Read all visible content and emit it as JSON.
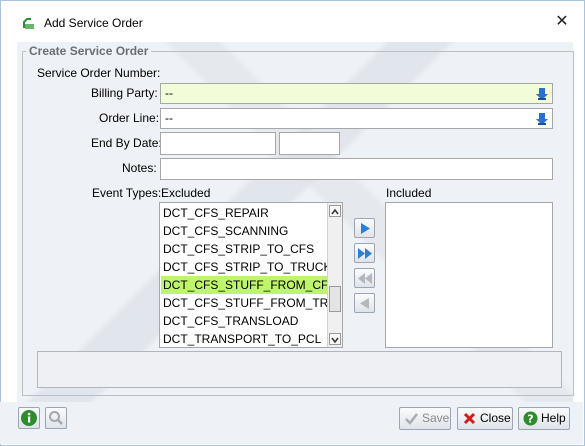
{
  "window": {
    "title": "Add Service Order"
  },
  "group": {
    "legend": "Create Service Order"
  },
  "form": {
    "service_order_number_label": "Service Order Number:",
    "billing_party_label": "Billing Party:",
    "billing_party_value": "--",
    "order_line_label": "Order Line:",
    "order_line_value": "--",
    "end_by_date_label": "End By Date:",
    "end_by_date_value": "",
    "end_by_time_value": "",
    "notes_label": "Notes:",
    "notes_value": "",
    "event_types_label": "Event Types:"
  },
  "excluded": {
    "header": "Excluded",
    "items": [
      "DCT_CFS_REPAIR",
      "DCT_CFS_SCANNING",
      "DCT_CFS_STRIP_TO_CFS",
      "DCT_CFS_STRIP_TO_TRUCK",
      "DCT_CFS_STUFF_FROM_CFS",
      "DCT_CFS_STUFF_FROM_TRUCK",
      "DCT_CFS_TRANSLOAD",
      "DCT_TRANSPORT_TO_PCL"
    ],
    "selected_index": 4
  },
  "included": {
    "header": "Included",
    "items": []
  },
  "buttons": {
    "save": "Save",
    "close": "Close",
    "help": "Help"
  },
  "colors": {
    "selection": "#bff56d",
    "required_field": "#f2fcd9",
    "panel": "#eef1f5"
  }
}
